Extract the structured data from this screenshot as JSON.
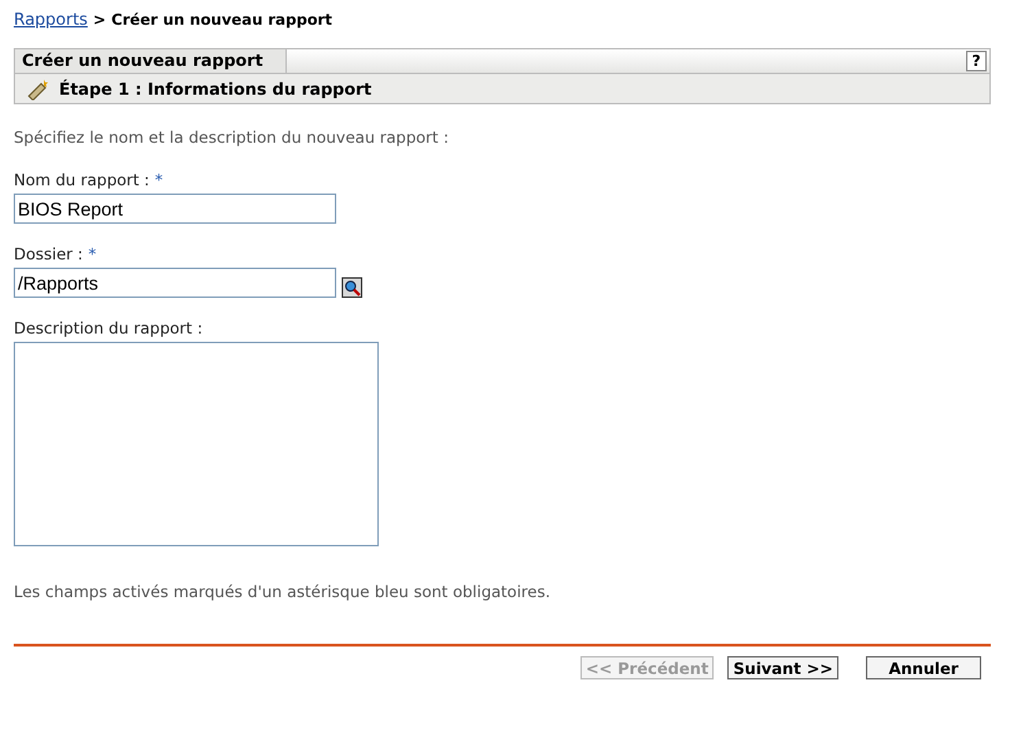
{
  "breadcrumb": {
    "link": "Rapports",
    "separator": ">",
    "current": "Créer un nouveau rapport"
  },
  "panel": {
    "title": "Créer un nouveau rapport",
    "help": "?",
    "step": "Étape 1 : Informations du rapport"
  },
  "intro": "Spécifiez le nom et la description du nouveau rapport :",
  "fields": [
    {
      "kind": "text",
      "label": "Nom du rapport :",
      "required": true,
      "value": "BIOS Report",
      "browse": false
    },
    {
      "kind": "text",
      "label": "Dossier :",
      "required": true,
      "value": "/Rapports",
      "browse": true
    },
    {
      "kind": "textarea",
      "label": "Description du rapport :",
      "required": false,
      "browse": false
    }
  ],
  "required_mark": "*",
  "note": "Les champs activés marqués d'un astérisque bleu sont obligatoires.",
  "buttons": [
    {
      "label": "<< Précédent",
      "disabled": true
    },
    {
      "label": "Suivant >>",
      "disabled": false
    },
    {
      "label": "Annuler",
      "disabled": false
    }
  ]
}
